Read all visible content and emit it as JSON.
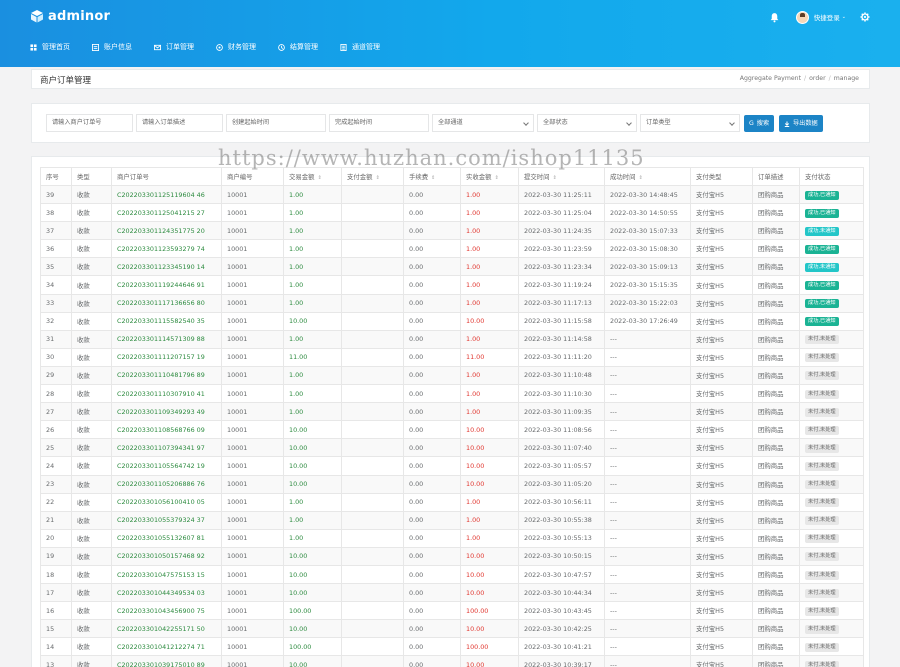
{
  "brand": {
    "name": "adminor"
  },
  "header": {
    "user_name": "快捷登录",
    "caret": "⌄"
  },
  "nav": [
    {
      "label": "管理首页",
      "icon": "home-icon"
    },
    {
      "label": "账户信息",
      "icon": "user-icon"
    },
    {
      "label": "订单管理",
      "icon": "order-icon"
    },
    {
      "label": "财务管理",
      "icon": "finance-icon"
    },
    {
      "label": "结算管理",
      "icon": "settle-icon"
    },
    {
      "label": "通道管理",
      "icon": "channel-icon"
    }
  ],
  "page": {
    "title": "商户订单管理",
    "breadcrumb": [
      "Aggregate Payment",
      "order",
      "manage"
    ]
  },
  "filters": {
    "merchant_order_placeholder": "请输入商户订单号",
    "order_desc_placeholder": "请输入订单描述",
    "created_start_placeholder": "创建起始时间",
    "completed_start_placeholder": "完成起始时间",
    "channel_select": "全部通道",
    "status_select": "全部状态",
    "type_select": "订单类型",
    "search_label": "搜索",
    "export_label": "导出数据"
  },
  "watermark": "https://www.huzhan.com/ishop11135",
  "table": {
    "columns": [
      "序号",
      "类型",
      "商户订单号",
      "商户编号",
      "交易金额",
      "支付金额",
      "手续费",
      "实收金额",
      "提交时间",
      "成功时间",
      "支付类型",
      "订单描述",
      "支付状态"
    ],
    "rows": [
      [
        "39",
        "收款",
        "C202203301125119604 46",
        "10001",
        "1.00",
        "",
        "0.00",
        "1.00",
        "2022-03-30 11:25:11",
        "2022-03-30 14:48:45",
        "支付宝H5",
        "团购商品",
        "成功,已通知"
      ],
      [
        "38",
        "收款",
        "C202203301125041215 27",
        "10001",
        "1.00",
        "",
        "0.00",
        "1.00",
        "2022-03-30 11:25:04",
        "2022-03-30 14:50:55",
        "支付宝H5",
        "团购商品",
        "成功,已通知"
      ],
      [
        "37",
        "收款",
        "C202203301124351775 20",
        "10001",
        "1.00",
        "",
        "0.00",
        "1.00",
        "2022-03-30 11:24:35",
        "2022-03-30 15:07:33",
        "支付宝H5",
        "团购商品",
        "成功,未通知"
      ],
      [
        "36",
        "收款",
        "C202203301123593279 74",
        "10001",
        "1.00",
        "",
        "0.00",
        "1.00",
        "2022-03-30 11:23:59",
        "2022-03-30 15:08:30",
        "支付宝H5",
        "团购商品",
        "成功,已通知"
      ],
      [
        "35",
        "收款",
        "C202203301123345190 14",
        "10001",
        "1.00",
        "",
        "0.00",
        "1.00",
        "2022-03-30 11:23:34",
        "2022-03-30 15:09:13",
        "支付宝H5",
        "团购商品",
        "成功,未通知"
      ],
      [
        "34",
        "收款",
        "C202203301119244646 91",
        "10001",
        "1.00",
        "",
        "0.00",
        "1.00",
        "2022-03-30 11:19:24",
        "2022-03-30 15:15:35",
        "支付宝H5",
        "团购商品",
        "成功,已通知"
      ],
      [
        "33",
        "收款",
        "C202203301117136656 80",
        "10001",
        "1.00",
        "",
        "0.00",
        "1.00",
        "2022-03-30 11:17:13",
        "2022-03-30 15:22:03",
        "支付宝H5",
        "团购商品",
        "成功,已通知"
      ],
      [
        "32",
        "收款",
        "C202203301115582540 35",
        "10001",
        "10.00",
        "",
        "0.00",
        "10.00",
        "2022-03-30 11:15:58",
        "2022-03-30 17:26:49",
        "支付宝H5",
        "团购商品",
        "成功,已通知"
      ],
      [
        "31",
        "收款",
        "C202203301114571309 88",
        "10001",
        "1.00",
        "",
        "0.00",
        "1.00",
        "2022-03-30 11:14:58",
        "---",
        "支付宝H5",
        "团购商品",
        "未付,未处理"
      ],
      [
        "30",
        "收款",
        "C202203301111207157 19",
        "10001",
        "11.00",
        "",
        "0.00",
        "11.00",
        "2022-03-30 11:11:20",
        "---",
        "支付宝H5",
        "团购商品",
        "未付,未处理"
      ],
      [
        "29",
        "收款",
        "C202203301110481796 89",
        "10001",
        "1.00",
        "",
        "0.00",
        "1.00",
        "2022-03-30 11:10:48",
        "---",
        "支付宝H5",
        "团购商品",
        "未付,未处理"
      ],
      [
        "28",
        "收款",
        "C202203301110307910 41",
        "10001",
        "1.00",
        "",
        "0.00",
        "1.00",
        "2022-03-30 11:10:30",
        "---",
        "支付宝H5",
        "团购商品",
        "未付,未处理"
      ],
      [
        "27",
        "收款",
        "C202203301109349293 49",
        "10001",
        "1.00",
        "",
        "0.00",
        "1.00",
        "2022-03-30 11:09:35",
        "---",
        "支付宝H5",
        "团购商品",
        "未付,未处理"
      ],
      [
        "26",
        "收款",
        "C202203301108568766 09",
        "10001",
        "10.00",
        "",
        "0.00",
        "10.00",
        "2022-03-30 11:08:56",
        "---",
        "支付宝H5",
        "团购商品",
        "未付,未处理"
      ],
      [
        "25",
        "收款",
        "C202203301107394341 97",
        "10001",
        "10.00",
        "",
        "0.00",
        "10.00",
        "2022-03-30 11:07:40",
        "---",
        "支付宝H5",
        "团购商品",
        "未付,未处理"
      ],
      [
        "24",
        "收款",
        "C202203301105564742 19",
        "10001",
        "10.00",
        "",
        "0.00",
        "10.00",
        "2022-03-30 11:05:57",
        "---",
        "支付宝H5",
        "团购商品",
        "未付,未处理"
      ],
      [
        "23",
        "收款",
        "C202203301105206886 76",
        "10001",
        "10.00",
        "",
        "0.00",
        "10.00",
        "2022-03-30 11:05:20",
        "---",
        "支付宝H5",
        "团购商品",
        "未付,未处理"
      ],
      [
        "22",
        "收款",
        "C202203301056100410 05",
        "10001",
        "1.00",
        "",
        "0.00",
        "1.00",
        "2022-03-30 10:56:11",
        "---",
        "支付宝H5",
        "团购商品",
        "未付,未处理"
      ],
      [
        "21",
        "收款",
        "C202203301055379324 37",
        "10001",
        "1.00",
        "",
        "0.00",
        "1.00",
        "2022-03-30 10:55:38",
        "---",
        "支付宝H5",
        "团购商品",
        "未付,未处理"
      ],
      [
        "20",
        "收款",
        "C202203301055132607 81",
        "10001",
        "1.00",
        "",
        "0.00",
        "1.00",
        "2022-03-30 10:55:13",
        "---",
        "支付宝H5",
        "团购商品",
        "未付,未处理"
      ],
      [
        "19",
        "收款",
        "C202203301050157468 92",
        "10001",
        "10.00",
        "",
        "0.00",
        "10.00",
        "2022-03-30 10:50:15",
        "---",
        "支付宝H5",
        "团购商品",
        "未付,未处理"
      ],
      [
        "18",
        "收款",
        "C202203301047575153 15",
        "10001",
        "10.00",
        "",
        "0.00",
        "10.00",
        "2022-03-30 10:47:57",
        "---",
        "支付宝H5",
        "团购商品",
        "未付,未处理"
      ],
      [
        "17",
        "收款",
        "C202203301044349534 03",
        "10001",
        "10.00",
        "",
        "0.00",
        "10.00",
        "2022-03-30 10:44:34",
        "---",
        "支付宝H5",
        "团购商品",
        "未付,未处理"
      ],
      [
        "16",
        "收款",
        "C202203301043456900 75",
        "10001",
        "100.00",
        "",
        "0.00",
        "100.00",
        "2022-03-30 10:43:45",
        "---",
        "支付宝H5",
        "团购商品",
        "未付,未处理"
      ],
      [
        "15",
        "收款",
        "C202203301042255171 50",
        "10001",
        "10.00",
        "",
        "0.00",
        "10.00",
        "2022-03-30 10:42:25",
        "---",
        "支付宝H5",
        "团购商品",
        "未付,未处理"
      ],
      [
        "14",
        "收款",
        "C202203301041212274 71",
        "10001",
        "100.00",
        "",
        "0.00",
        "100.00",
        "2022-03-30 10:41:21",
        "---",
        "支付宝H5",
        "团购商品",
        "未付,未处理"
      ],
      [
        "13",
        "收款",
        "C202203301039175010 89",
        "10001",
        "10.00",
        "",
        "0.00",
        "10.00",
        "2022-03-30 10:39:17",
        "---",
        "支付宝H5",
        "团购商品",
        "未付,未处理"
      ]
    ]
  },
  "colors": {
    "header_start": "#1a8fe0",
    "header_end": "#1ab0ee",
    "primary": "#1c84c6",
    "success_badge": "#1ab394",
    "info_badge": "#23c6c8",
    "amount_green": "#2b8a3e",
    "amount_red": "#e0342d"
  }
}
